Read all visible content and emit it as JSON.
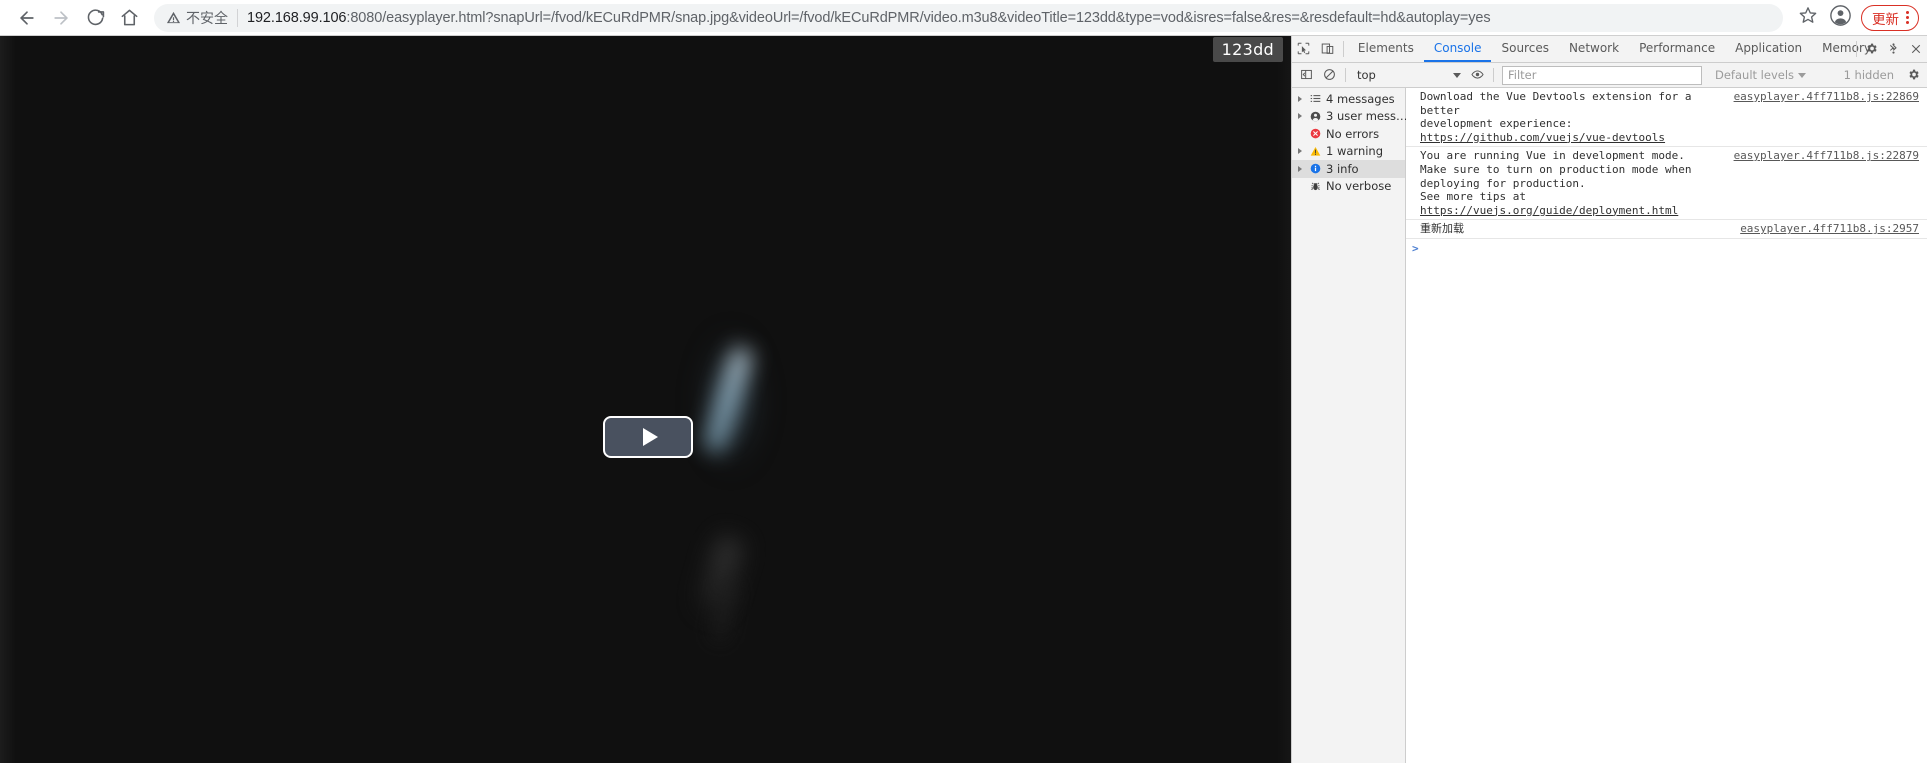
{
  "browser": {
    "nav": {
      "back_icon": "arrow-left-icon",
      "forward_icon": "arrow-right-icon",
      "reload_icon": "reload-icon",
      "home_icon": "home-icon"
    },
    "security": {
      "icon": "warning-triangle-icon",
      "label": "不安全"
    },
    "url": "192.168.99.106:8080/easyplayer.html?snapUrl=/fvod/kECuRdPMR/snap.jpg&videoUrl=/fvod/kECuRdPMR/video.m3u8&videoTitle=123dd&type=vod&isres=false&res=&resdefault=hd&autoplay=yes",
    "url_host": "192.168.99.106",
    "url_rest": ":8080/easyplayer.html?snapUrl=/fvod/kECuRdPMR/snap.jpg&videoUrl=/fvod/kECuRdPMR/video.m3u8&videoTitle=123dd&type=vod&isres=false&res=&resdefault=hd&autoplay=yes",
    "actions": {
      "bookmark_icon": "star-icon",
      "profile_icon": "avatar-icon",
      "update_label": "更新",
      "menu_icon": "kebab-menu-icon"
    },
    "accent_red": "#d93025"
  },
  "player": {
    "title_badge": "123dd",
    "play_button_icon": "play-triangle-icon",
    "play_button_fill": "#49515f",
    "background": "#101010"
  },
  "devtools": {
    "tools": {
      "inspect_icon": "inspect-element-icon",
      "device_icon": "device-toolbar-icon",
      "settings_icon": "gear-icon",
      "more_icon": "kebab-menu-icon",
      "close_icon": "close-icon",
      "overflow_label": "»"
    },
    "tabs": [
      {
        "label": "Elements",
        "active": false
      },
      {
        "label": "Console",
        "active": true
      },
      {
        "label": "Sources",
        "active": false
      },
      {
        "label": "Network",
        "active": false
      },
      {
        "label": "Performance",
        "active": false
      },
      {
        "label": "Application",
        "active": false
      },
      {
        "label": "Memory",
        "active": false
      }
    ],
    "console_toolbar": {
      "sidebar_toggle_icon": "console-sidebar-icon",
      "clear_icon": "clear-console-icon",
      "context_value": "top",
      "eye_icon": "live-expression-icon",
      "filter_placeholder": "Filter",
      "filter_value": "",
      "levels_label": "Default levels",
      "hidden_label": "1 hidden",
      "settings_icon": "gear-icon"
    },
    "sidebar": [
      {
        "label": "4 messages",
        "icon": "list-icon",
        "expandable": true,
        "selected": false
      },
      {
        "label": "3 user mess…",
        "icon": "person-icon",
        "expandable": true,
        "selected": false
      },
      {
        "label": "No errors",
        "icon": "error-icon",
        "expandable": false,
        "selected": false
      },
      {
        "label": "1 warning",
        "icon": "warning-icon",
        "expandable": true,
        "selected": false
      },
      {
        "label": "3 info",
        "icon": "info-icon",
        "expandable": true,
        "selected": true
      },
      {
        "label": "No verbose",
        "icon": "bug-icon",
        "expandable": false,
        "selected": false
      }
    ],
    "messages": [
      {
        "line1": "Download the Vue Devtools extension for a better",
        "line2": "development experience:",
        "link": "https://github.com/vuejs/vue-devtools",
        "source": "easyplayer.4ff711b8.js:22869"
      },
      {
        "line1": "You are running Vue in development mode.",
        "line2": "Make sure to turn on production mode when deploying for production.",
        "line3_prefix": "See more tips at ",
        "link": "https://vuejs.org/guide/deployment.html",
        "source": "easyplayer.4ff711b8.js:22879"
      },
      {
        "line1": "重新加载",
        "source": "easyplayer.4ff711b8.js:2957"
      }
    ],
    "prompt": ">"
  }
}
